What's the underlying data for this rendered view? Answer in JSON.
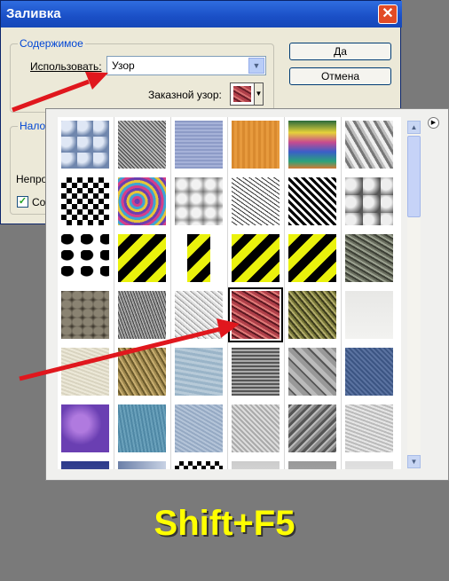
{
  "window": {
    "title": "Заливка",
    "close_glyph": "✕"
  },
  "content_group": {
    "label": "Содержимое",
    "use_label": "Использовать:",
    "use_value": "Узор",
    "custom_pattern_label": "Заказной узор:"
  },
  "buttons": {
    "ok": "Да",
    "cancel": "Отмена"
  },
  "blend_group": {
    "label_fragment": "Нало",
    "opacity_fragment": "Непро",
    "preserve_fragment": "Сох",
    "preserve_checked": true
  },
  "picker": {
    "selected_cell": 21,
    "patterns": [
      "bubbles-blue",
      "noise-gray",
      "fabric-blue",
      "wood-orange",
      "rainbow-waves",
      "crumpled-foil",
      "checker-bw",
      "tie-dye",
      "clouds-gray",
      "crackle-lines",
      "herringbone-bw",
      "marble-gray",
      "cow-spots",
      "hazard-stripes",
      "hazard-stripe-narrow",
      "hazard-stripes",
      "hazard-stripes",
      "granite-dark",
      "pebbles",
      "granite-gray",
      "speckle-white",
      "red-granite",
      "moss-texture",
      "paper-light",
      "paper-cream",
      "sand-tan",
      "water-blue",
      "woven-mesh",
      "basket-weave",
      "denim-blue",
      "purple-clouds",
      "teal-grain",
      "blue-grain",
      "stucco-gray",
      "diagonal-brush",
      "stucco-light",
      "dark-blue",
      "gradient",
      "checker-partial",
      "silver",
      "gray",
      "gray-light"
    ]
  },
  "shortcut_text": "Shift+F5",
  "icons": [
    "close-icon",
    "dropdown-arrow-icon",
    "flyout-menu-icon",
    "scroll-up-icon",
    "scroll-down-icon",
    "checkbox-check-icon"
  ]
}
